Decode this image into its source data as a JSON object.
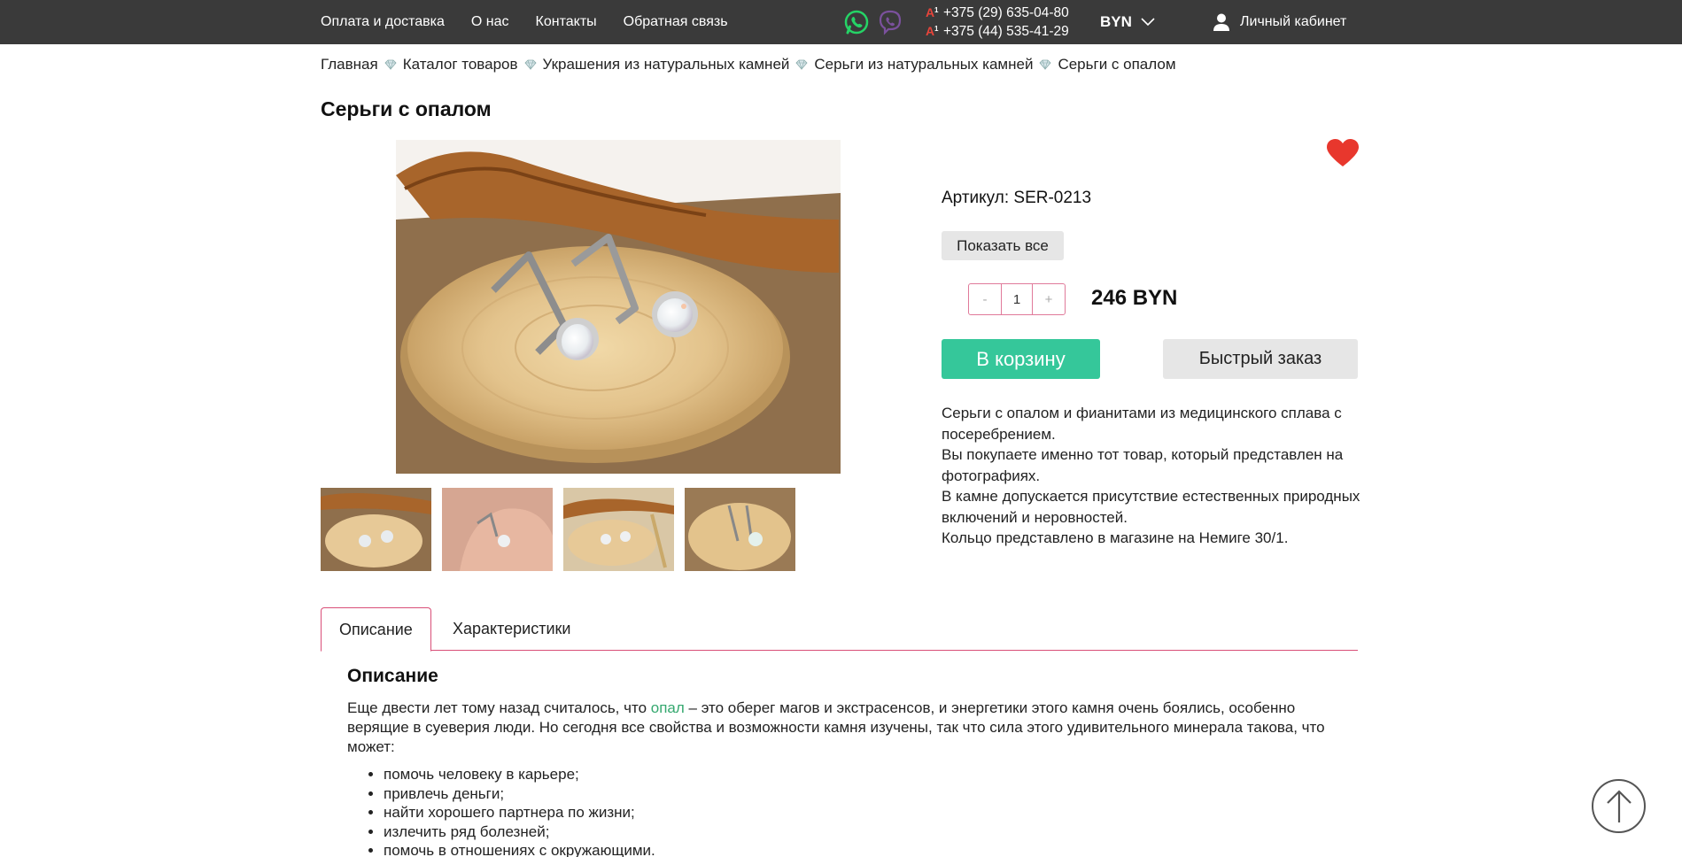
{
  "topnav": {
    "items": [
      "Оплата и доставка",
      "О нас",
      "Контакты",
      "Обратная связь"
    ]
  },
  "messengers": [
    "whatsapp-icon",
    "viber-icon"
  ],
  "phones": [
    "+375 (29) 635-04-80",
    "+375 (44) 535-41-29"
  ],
  "phone_operator_logo": "A",
  "phone_operator_superscript": "1",
  "currency": "BYN",
  "account_label": "Личный кабинет",
  "breadcrumb": [
    "Главная",
    "Каталог товаров",
    "Украшения из натуральных камней",
    "Серьги из натуральных камней",
    "Серьги с опалом"
  ],
  "title": "Серьги с опалом",
  "product": {
    "sku": "Артикул: SER-0213",
    "show_all": "Показать все",
    "quantity": "1",
    "minus": "-",
    "plus": "+",
    "price": "246 BYN",
    "cart_button": "В корзину",
    "quick_order": "Быстрый заказ",
    "description": [
      "Серьги с опалом и фианитами из медицинского сплава с посеребрением.",
      "Вы покупаете именно тот товар, который представлен на фотографиях.",
      "В камне допускается присутствие естественных природных включений и неровностей.",
      "Кольцо представлено в магазине на Немиге 30/1."
    ]
  },
  "tabs": [
    "Описание",
    "Характеристики"
  ],
  "section": {
    "title": "Описание",
    "intro_before": "Еще двести лет тому назад считалось, что ",
    "intro_link": "опал",
    "intro_after": " – это оберег магов и экстрасенсов, и энергетики этого камня очень боялись, особенно верящие в суеверия люди. Но сегодня все свойства и возможности камня изучены, так что сила этого удивительного минерала такова, что может:",
    "bullets": [
      "помочь человеку в карьере;",
      "привлечь деньги;",
      "найти хорошего партнера по жизни;",
      "излечить ряд болезней;",
      "помочь в отношениях с окружающими."
    ]
  },
  "colors": {
    "topbar": "#3a3a3a",
    "accent_green": "#35c79a",
    "accent_pink": "#d94f78",
    "heart": "#e8372d",
    "link_green": "#35a86f"
  }
}
